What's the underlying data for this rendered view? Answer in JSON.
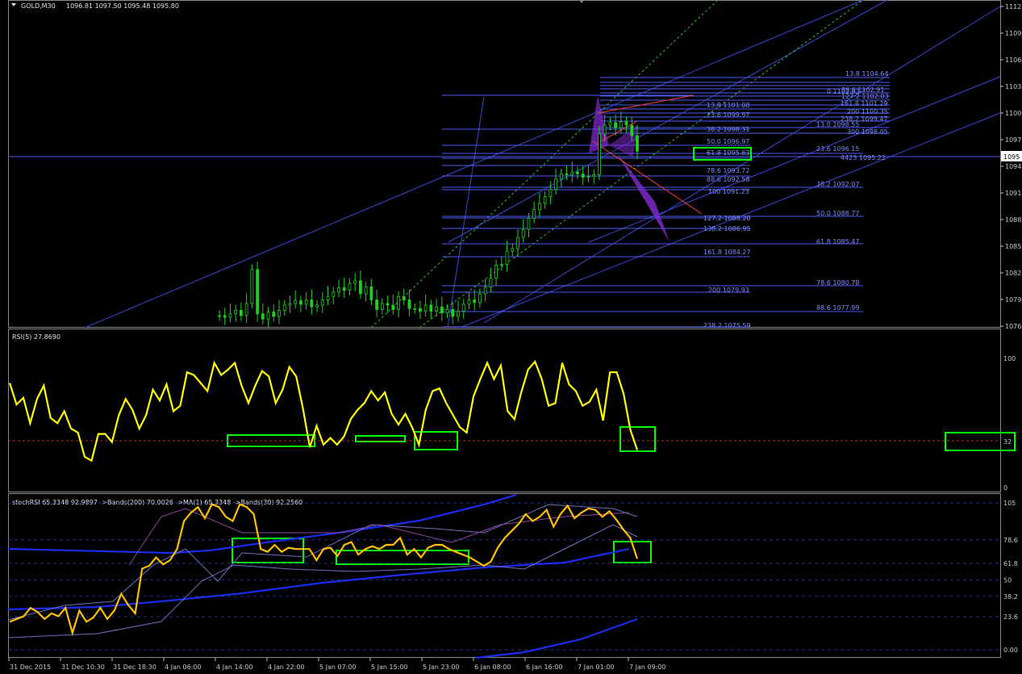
{
  "header": {
    "symbol": "GOLD,M30",
    "ohlc": "1096.81 1097.50 1095.48 1095.80",
    "rsi": "RSI(5) 27.8690",
    "stoch": "stochRSI 65.3348 92.9897  ->Bands(200) 70.0026  ->MA(1) 65.3348  ->Bands(30) 92.2560"
  },
  "colors": {
    "background": "#000000",
    "fib": "#4b5cf0",
    "channel": "#3848d8",
    "candle": "#20d020",
    "rsi_line": "#ffff00",
    "stoch_line": "#ffc000",
    "ma_line": "#1a2cf0",
    "highlight": "#00ff00",
    "pattern": "#7b28c8",
    "red_line": "#ff3c28",
    "grid_dash": "#2030a0"
  },
  "price_axis": {
    "ticks": [
      "1112",
      "1109",
      "1106",
      "1103",
      "1100",
      "1097",
      "1094",
      "1091",
      "1088",
      "1085",
      "1082",
      "1079",
      "1076"
    ],
    "current": "1095"
  },
  "rsi_axis": {
    "ticks": [
      "100",
      "0"
    ],
    "level_label": "32"
  },
  "stoch_axis": {
    "ticks": [
      "105",
      "78.6",
      "61.8",
      "50",
      "38.2",
      "23.6",
      "0.00"
    ]
  },
  "time_axis": [
    "31 Dec 2015",
    "31 Dec 10:30",
    "31 Dec 18:30",
    "4 Jan 06:00",
    "4 Jan 14:00",
    "4 Jan 22:00",
    "5 Jan 07:00",
    "5 Jan 15:00",
    "5 Jan 23:00",
    "6 Jan 08:00",
    "6 Jan 16:00",
    "7 Jan 01:00",
    "7 Jan 09:00"
  ],
  "fib_labels": [
    {
      "text": "13.8 1104.64"
    },
    {
      "text": "88.6 1102.91"
    },
    {
      "text": "0 1102.83"
    },
    {
      "text": "127.2 1102.03"
    },
    {
      "text": "13.8 1101.08"
    },
    {
      "text": "161.8 1101.29"
    },
    {
      "text": "200 1100.35"
    },
    {
      "text": "23.6 1099.97"
    },
    {
      "text": "238.2 1099.47"
    },
    {
      "text": "13.0 1098.55"
    },
    {
      "text": "38.2 1098.31"
    },
    {
      "text": "300 1098.05"
    },
    {
      "text": "50.0 1096.97"
    },
    {
      "text": "23.6 1096.15"
    },
    {
      "text": "61.8 1095.63"
    },
    {
      "text": "4423 1095.22"
    },
    {
      "text": "78.6 1093.72"
    },
    {
      "text": "88.6 1092.58"
    },
    {
      "text": "38.2 1092.07"
    },
    {
      "text": "100 1091.23"
    },
    {
      "text": "50.0 1088.77"
    },
    {
      "text": "127.2 1088.20"
    },
    {
      "text": "138.2 1086.95"
    },
    {
      "text": "61.8 1085.47"
    },
    {
      "text": "161.8 1084.27"
    },
    {
      "text": "78.6 1080.78"
    },
    {
      "text": "200 1079.93"
    },
    {
      "text": "88.6 1077.99"
    },
    {
      "text": "238.2 1075.59"
    }
  ],
  "chart_data": [
    {
      "type": "candlestick",
      "price_range": [
        1075.5,
        1113.2
      ],
      "price_samples": [
        1076.9,
        1076.7,
        1077.1,
        1077.5,
        1076.9,
        1078.3,
        1082.2,
        1077.1,
        1076.5,
        1077.3,
        1076.8,
        1077.5,
        1078.1,
        1078.3,
        1078.6,
        1078.2,
        1078.7,
        1077.9,
        1078.1,
        1078.7,
        1079.1,
        1079.6,
        1080.1,
        1079.8,
        1080.6,
        1080.9,
        1079.4,
        1080.2,
        1078.7,
        1077.6,
        1078.3,
        1078.1,
        1077.6,
        1079.1,
        1078.7,
        1077.7,
        1077.7,
        1077.4,
        1078.1,
        1077.4,
        1077.9,
        1077.2,
        1077.6,
        1076.8,
        1077.4,
        1078.2,
        1078.7,
        1078.4,
        1079.4,
        1080.2,
        1081.2,
        1082.7,
        1082.8,
        1084.3,
        1084.6,
        1085.9,
        1086.8,
        1088.1,
        1089.1,
        1089.8,
        1090.6,
        1091.4,
        1092.6,
        1093.2,
        1093.1,
        1093.4,
        1093.2,
        1092.8,
        1092.9,
        1093.1,
        1097.8,
        1098.8,
        1099.1,
        1098.5,
        1099.2,
        1098.8,
        1097.6,
        1095.8
      ],
      "current_price": 1095.8
    },
    {
      "type": "line",
      "name": "RSI(5)",
      "ylim": [
        0,
        100
      ],
      "level": 32,
      "values": [
        78,
        62,
        67,
        48,
        66,
        76,
        52,
        48,
        57,
        44,
        41,
        23,
        20,
        40,
        40,
        34,
        54,
        66,
        58,
        44,
        54,
        73,
        65,
        77,
        57,
        61,
        86,
        84,
        78,
        72,
        93,
        84,
        88,
        93,
        76,
        63,
        76,
        87,
        83,
        63,
        73,
        90,
        83,
        59,
        30,
        46,
        32,
        37,
        32,
        38,
        51,
        58,
        63,
        72,
        65,
        71,
        55,
        47,
        55,
        45,
        32,
        58,
        72,
        74,
        63,
        54,
        45,
        41,
        68,
        81,
        93,
        81,
        91,
        57,
        51,
        71,
        88,
        94,
        81,
        61,
        63,
        93,
        77,
        72,
        61,
        64,
        73,
        50,
        86,
        86,
        70,
        43,
        28
      ]
    },
    {
      "type": "line",
      "name": "stochRSI",
      "ylim": [
        0,
        105
      ],
      "levels": [
        105,
        78.6,
        61.8,
        50,
        38.2,
        23.6,
        0
      ],
      "values": [
        20,
        22,
        24,
        30,
        27,
        22,
        26,
        24,
        30,
        12,
        28,
        20,
        23,
        30,
        22,
        28,
        40,
        32,
        26,
        58,
        60,
        66,
        61,
        64,
        72,
        92,
        98,
        102,
        94,
        104,
        102,
        95,
        92,
        104,
        102,
        97,
        72,
        70,
        75,
        70,
        73,
        72,
        72,
        72,
        64,
        72,
        73,
        67,
        75,
        77,
        68,
        72,
        74,
        72,
        75,
        75,
        80,
        68,
        72,
        66,
        73,
        75,
        75,
        72,
        70,
        68,
        66,
        63,
        60,
        63,
        73,
        80,
        85,
        90,
        97,
        92,
        95,
        100,
        88,
        97,
        103,
        94,
        98,
        101,
        100,
        95,
        99,
        93,
        86,
        80,
        65
      ]
    }
  ]
}
